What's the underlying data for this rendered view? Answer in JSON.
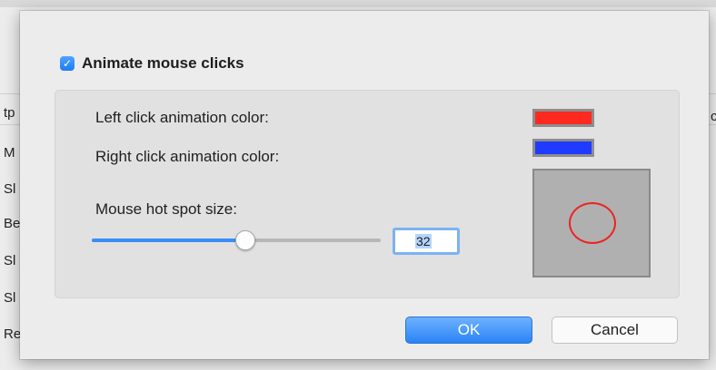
{
  "background": {
    "fragments": [
      "tp",
      "M",
      "Sl",
      "Be",
      "Sl",
      "Sl",
      "Re"
    ],
    "right_fragment": "c"
  },
  "dialog": {
    "animate_checkbox": {
      "label": "Animate mouse clicks",
      "checked": true
    },
    "left_click_label": "Left click animation color:",
    "right_click_label": "Right click animation color:",
    "hot_spot_label": "Mouse hot spot size:",
    "left_click_color": "#ff2a1f",
    "right_click_color": "#1f3bff",
    "hot_spot_size": "32",
    "slider_fraction": 0.53,
    "preview_circle_color": "#ee2222",
    "ok_label": "OK",
    "cancel_label": "Cancel"
  }
}
